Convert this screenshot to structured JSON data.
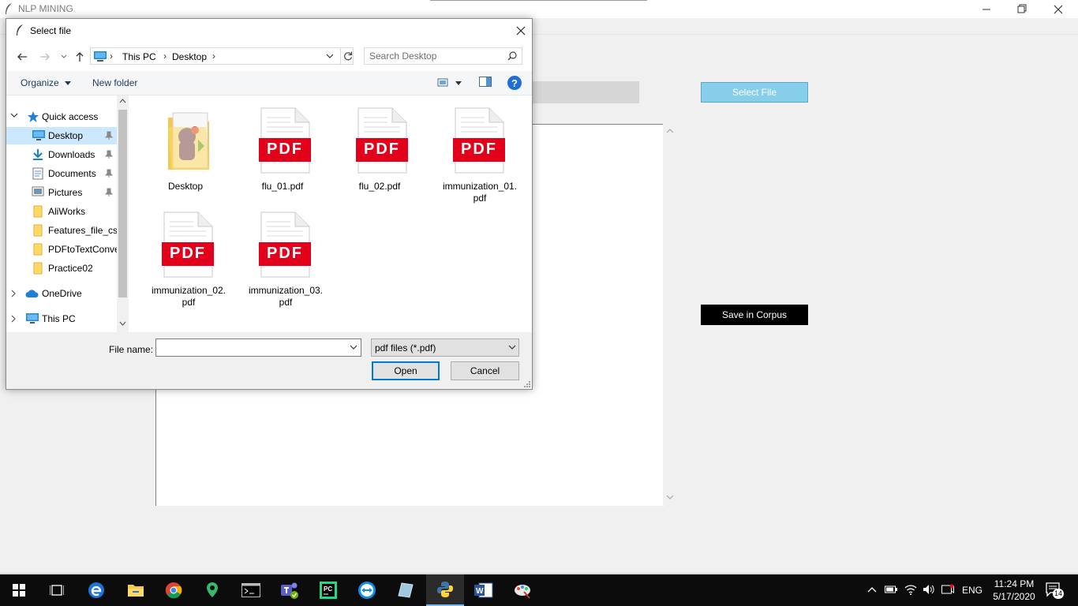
{
  "app": {
    "title": "NLP MINING",
    "select_file_label": "Select File",
    "save_corpus_label": "Save in Corpus"
  },
  "dialog": {
    "title": "Select file",
    "breadcrumbs": [
      "This PC",
      "Desktop"
    ],
    "search_placeholder": "Search Desktop",
    "organize_label": "Organize",
    "new_folder_label": "New folder",
    "help_glyph": "?",
    "nav": {
      "items": [
        {
          "label": "Quick access"
        },
        {
          "label": "Desktop"
        },
        {
          "label": "Downloads"
        },
        {
          "label": "Documents"
        },
        {
          "label": "Pictures"
        },
        {
          "label": "AliWorks"
        },
        {
          "label": "Features_file_csv"
        },
        {
          "label": "PDFtoTextConverter"
        },
        {
          "label": "Practice02"
        },
        {
          "label": "OneDrive"
        },
        {
          "label": "This PC"
        }
      ]
    },
    "files": [
      {
        "name": "Desktop",
        "type": "folder"
      },
      {
        "name": "flu_01.pdf",
        "type": "pdf"
      },
      {
        "name": "flu_02.pdf",
        "type": "pdf"
      },
      {
        "name": "immunization_01.pdf",
        "type": "pdf"
      },
      {
        "name": "immunization_02.pdf",
        "type": "pdf"
      },
      {
        "name": "immunization_03.pdf",
        "type": "pdf"
      }
    ],
    "pdf_badge": "PDF",
    "file_name_label": "File name:",
    "file_name_value": "",
    "file_type_value": "pdf files (*.pdf)",
    "open_label": "Open",
    "cancel_label": "Cancel"
  },
  "taskbar": {
    "language": "ENG",
    "time": "11:24 PM",
    "date": "5/17/2020",
    "notification_count": "14"
  },
  "colors": {
    "accent": "#0078d7",
    "select_file_bg": "#87ceeb",
    "save_corpus_bg": "#000000",
    "pdf_red": "#e2001a",
    "nav_selected": "#cce8ff"
  }
}
